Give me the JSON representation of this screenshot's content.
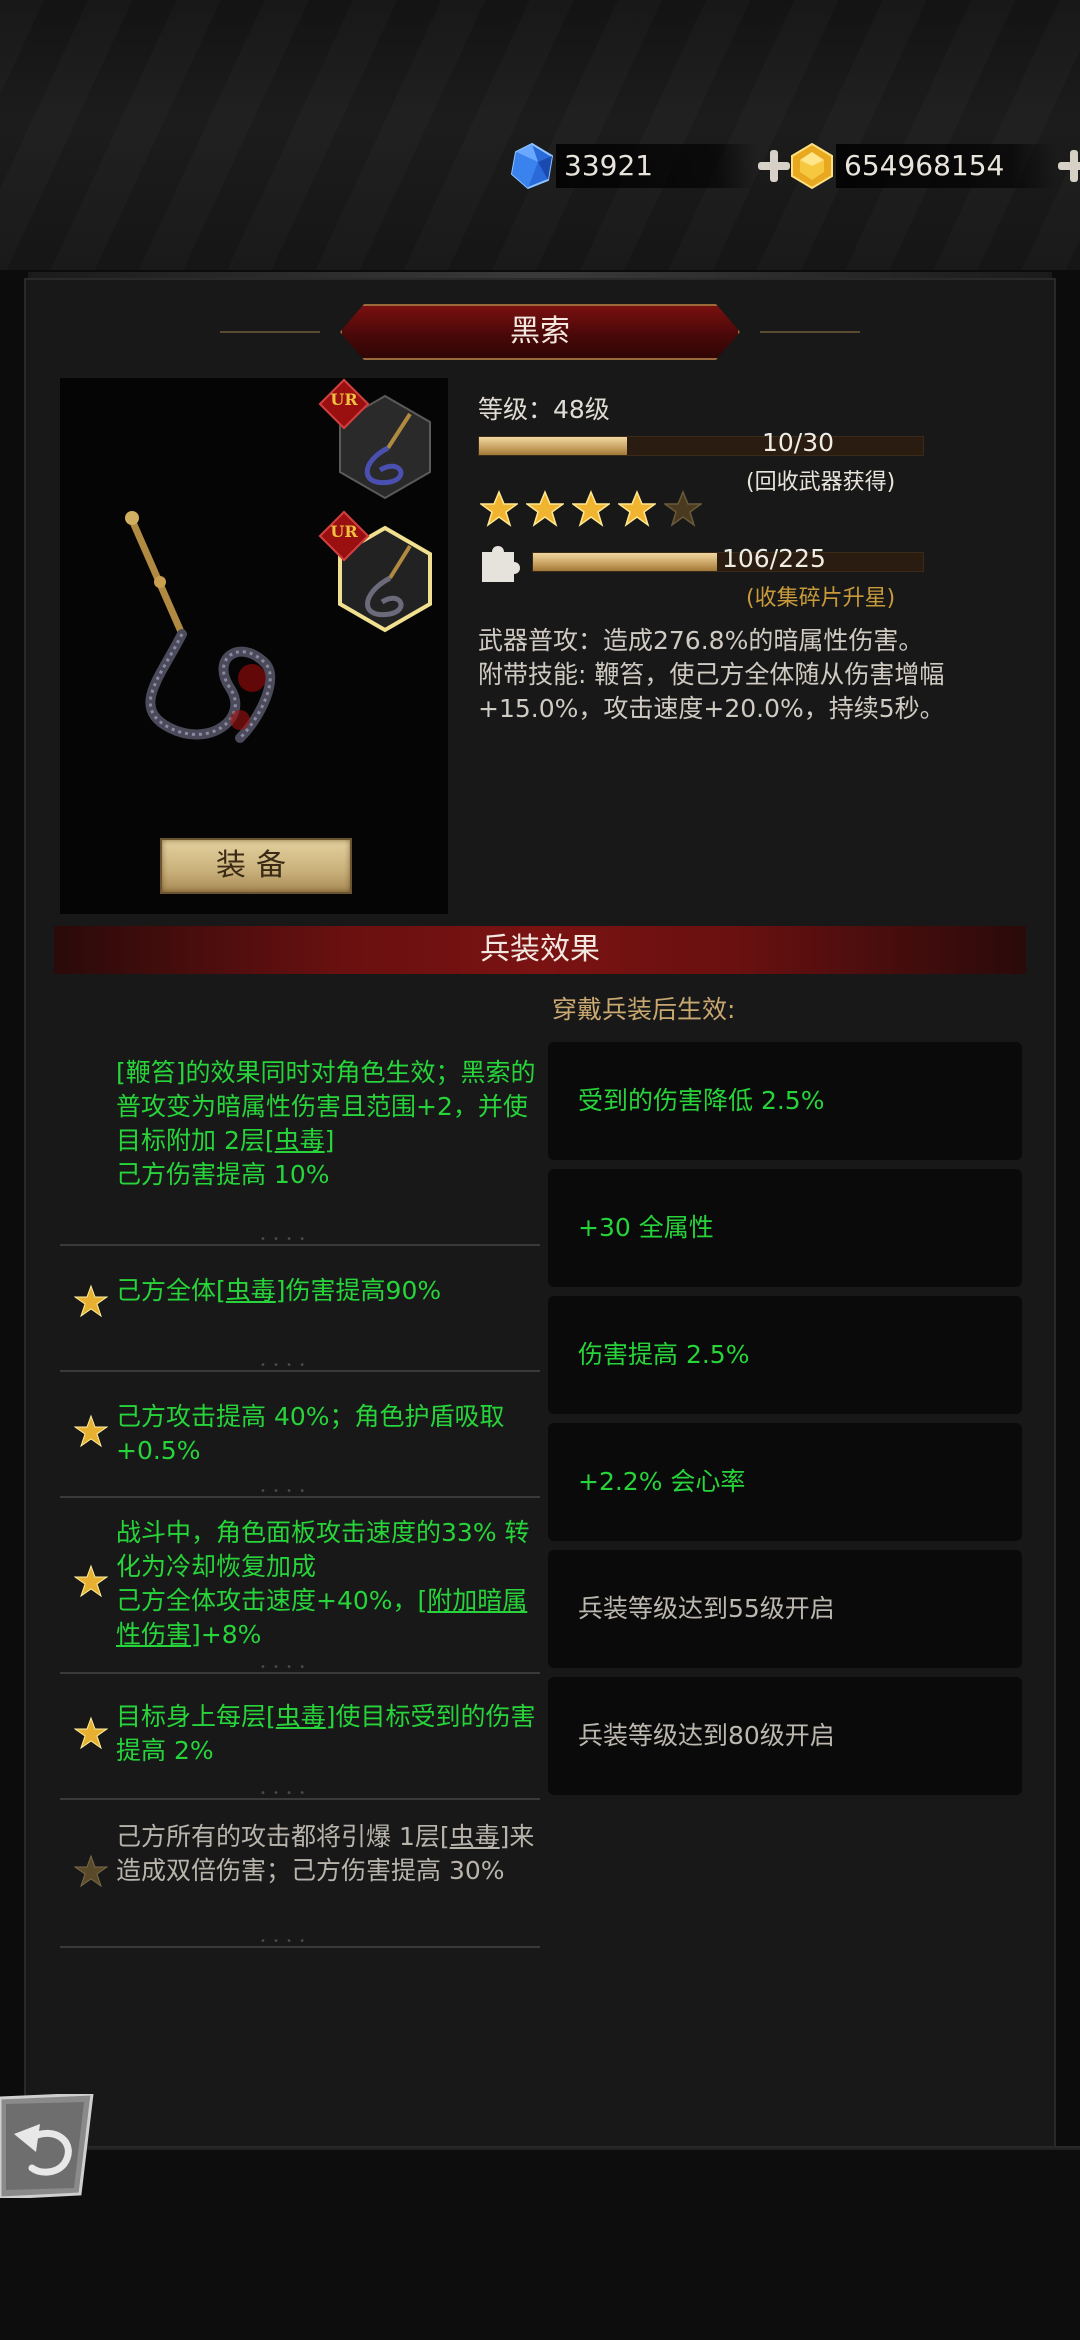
{
  "currency": {
    "gems": {
      "value": "33921",
      "icon": "blue-gem-icon"
    },
    "gold": {
      "value": "654968154",
      "icon": "gold-crystal-icon"
    }
  },
  "weapon": {
    "name": "黑索",
    "level_text": "等级：48级",
    "recycle": {
      "current": 10,
      "max": 30,
      "label": "10/30",
      "note": "(回收武器获得)"
    },
    "stars": {
      "filled": 4,
      "total": 5
    },
    "fragments": {
      "current": 106,
      "max": 225,
      "label": "106/225",
      "note": "(收集碎片升星)"
    },
    "desc1": "武器普攻：造成276.8%的暗属性伤害。",
    "desc2": "附带技能: 鞭笞，使己方全体随从伤害增幅+15.0%，攻击速度+20.0%，持续5秒。",
    "slots": [
      {
        "badge": "UR"
      },
      {
        "badge": "UR"
      }
    ],
    "equip_label": "装备"
  },
  "effects": {
    "header": "兵装效果",
    "wear_label": "穿戴兵装后生效:",
    "left": [
      {
        "p1": "[鞭笞]的效果同时对角色生效；黑索的普攻变为暗属性伤害且范围+2，并使目标附加 2层[",
        "u": "虫毒",
        "p2": "]",
        "p3": "己方伤害提高 10%",
        "star": false,
        "active": true
      },
      {
        "p1": "己方全体[",
        "u": "虫毒",
        "p2": "]伤害提高90%",
        "star": true,
        "active": true
      },
      {
        "p1": "己方攻击提高 40%；角色护盾吸取+0.5%",
        "star": true,
        "active": true
      },
      {
        "p1": "战斗中，角色面板攻击速度的33% 转化为冷却恢复加成",
        "p2": "己方全体攻击速度+40%，[",
        "u": "附加暗属性伤害",
        "p3": "]+8%",
        "star": true,
        "active": true
      },
      {
        "p1": "目标身上每层[",
        "u": "虫毒",
        "p2": "]使目标受到的伤害提高 2%",
        "star": true,
        "active": true
      },
      {
        "p1": "己方所有的攻击都将引爆 1层[",
        "u": "虫毒",
        "p2": "]来造成双倍伤害；己方伤害提高 30%",
        "star": true,
        "active": false
      }
    ],
    "right": [
      {
        "text": "受到的伤害降低 2.5%",
        "locked": false
      },
      {
        "text": "+30 全属性",
        "locked": false
      },
      {
        "text": "伤害提高 2.5%",
        "locked": false
      },
      {
        "text": "+2.2% 会心率",
        "locked": false
      },
      {
        "text": "兵装等级达到55级开启",
        "locked": true
      },
      {
        "text": "兵装等级达到80级开启",
        "locked": true
      }
    ]
  },
  "colors": {
    "green": "#27d43a",
    "accent_red": "#7a1212",
    "gold": "#c8a060"
  },
  "back_icon": "back-arrow-icon"
}
